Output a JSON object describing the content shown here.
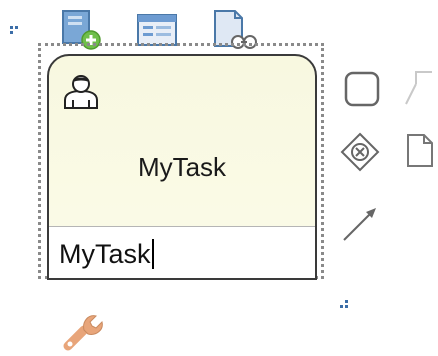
{
  "task": {
    "label": "MyTask",
    "editor_value": "MyTask"
  },
  "icons": {
    "top": [
      "add-data-icon",
      "form-icon",
      "task-inspector-icon"
    ],
    "right": [
      "task-shape-icon",
      "annotation-icon",
      "gateway-icon",
      "data-object-icon",
      "connector-arrow-icon"
    ],
    "bottom": [
      "wrench-icon"
    ]
  },
  "colors": {
    "task_fill": "#f8f8e0",
    "border": "#3a3a3a",
    "selection": "#8a8a8a",
    "handle": "#3c6ea8",
    "accent_blue": "#6d9bd1",
    "accent_green": "#6fbf4a",
    "wrench": "#e8a57a"
  }
}
